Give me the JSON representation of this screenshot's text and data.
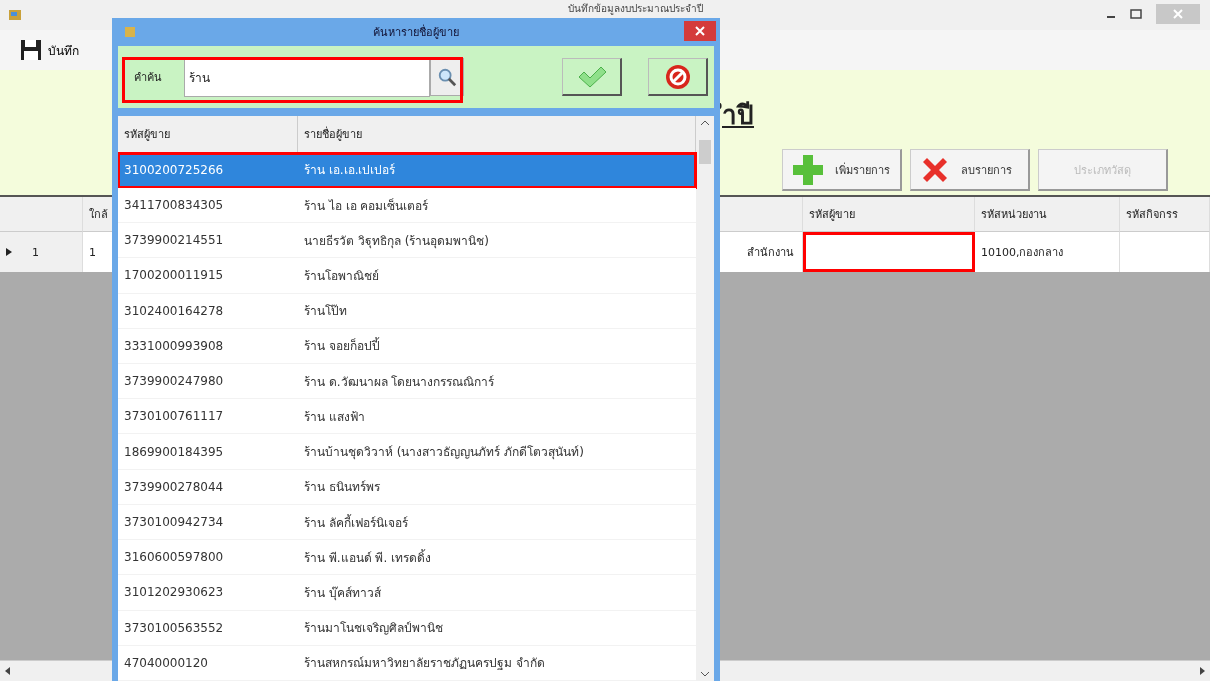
{
  "window": {
    "title": "บันทึกข้อมูลงบประมาณประจำปี"
  },
  "toolbar": {
    "save_label": "บันทึก"
  },
  "heading": "ำปี",
  "buttons": [
    {
      "kind": "add",
      "label": "เพิ่มรายการ",
      "disabled": false
    },
    {
      "kind": "delete",
      "label": "ลบรายการ",
      "disabled": false
    },
    {
      "kind": "plain",
      "label": "ประเภทวัสดุ",
      "disabled": true
    }
  ],
  "grid": {
    "column_1": "ใกล้",
    "seller_code": "รหัสผู้ขาย",
    "unit_code": "รหัสหน่วยงาน",
    "activity_code": "รหัสกิจกรร",
    "rows": [
      {
        "row_number": "1",
        "column_1": "1",
        "column_3": "สำนักงาน",
        "seller_code_highlighted": true,
        "unit_code": "10100,กองกลาง",
        "current": true
      }
    ]
  },
  "dialog": {
    "title": "ค้นหารายชื่อผู้ขาย",
    "search_label": "คำค้น",
    "search_value": "ร้าน",
    "search_highlighted": true,
    "columns": [
      "รหัสผู้ขาย",
      "รายชื่อผู้ขาย"
    ],
    "rows": [
      {
        "code": "3100200725266",
        "name": "ร้าน เอ.เอ.เปเปอร์",
        "selected": true,
        "highlighted": true
      },
      {
        "code": "3411700834305",
        "name": "ร้าน  ไอ เอ คอมเซ็นเตอร์",
        "selected": false,
        "highlighted": false
      },
      {
        "code": "3739900214551",
        "name": "นายธีรวัต  วิฐุทธิกุล (ร้านอุดมพานิช)",
        "selected": false,
        "highlighted": false
      },
      {
        "code": "1700200011915",
        "name": "ร้านโอพาณิชย์",
        "selected": false,
        "highlighted": false
      },
      {
        "code": "3102400164278",
        "name": "ร้านโป๊ท",
        "selected": false,
        "highlighted": false
      },
      {
        "code": "3331000993908",
        "name": "ร้าน จอยก็อปปี้",
        "selected": false,
        "highlighted": false
      },
      {
        "code": "3739900247980",
        "name": "ร้าน ด.วัฒนาผล โดยนางกรรณณิการ์",
        "selected": false,
        "highlighted": false
      },
      {
        "code": "3730100761117",
        "name": "ร้าน แสงฟ้า",
        "selected": false,
        "highlighted": false
      },
      {
        "code": "1869900184395",
        "name": "ร้านบ้านชุดวิวาห์ (นางสาวธัญญนภัทร์  ภักดีโตวสุนันท์)",
        "selected": false,
        "highlighted": false
      },
      {
        "code": "3739900278044",
        "name": "ร้าน  ธนินทร์พร",
        "selected": false,
        "highlighted": false
      },
      {
        "code": "3730100942734",
        "name": "ร้าน  ลัคกี้เฟอร์นิเจอร์",
        "selected": false,
        "highlighted": false
      },
      {
        "code": "3160600597800",
        "name": "ร้าน พี.แอนด์ พี. เทรดดิ้ง",
        "selected": false,
        "highlighted": false
      },
      {
        "code": "3101202930623",
        "name": "ร้าน  บุ๊คส์ทาวส์",
        "selected": false,
        "highlighted": false
      },
      {
        "code": "3730100563552",
        "name": "ร้านมาโนชเจริญศิลป์พานิช",
        "selected": false,
        "highlighted": false
      },
      {
        "code": "47040000120",
        "name": "ร้านสหกรณ์มหาวิทยาลัยราชภัฏนครปฐม  จำกัด",
        "selected": false,
        "highlighted": false
      }
    ]
  }
}
